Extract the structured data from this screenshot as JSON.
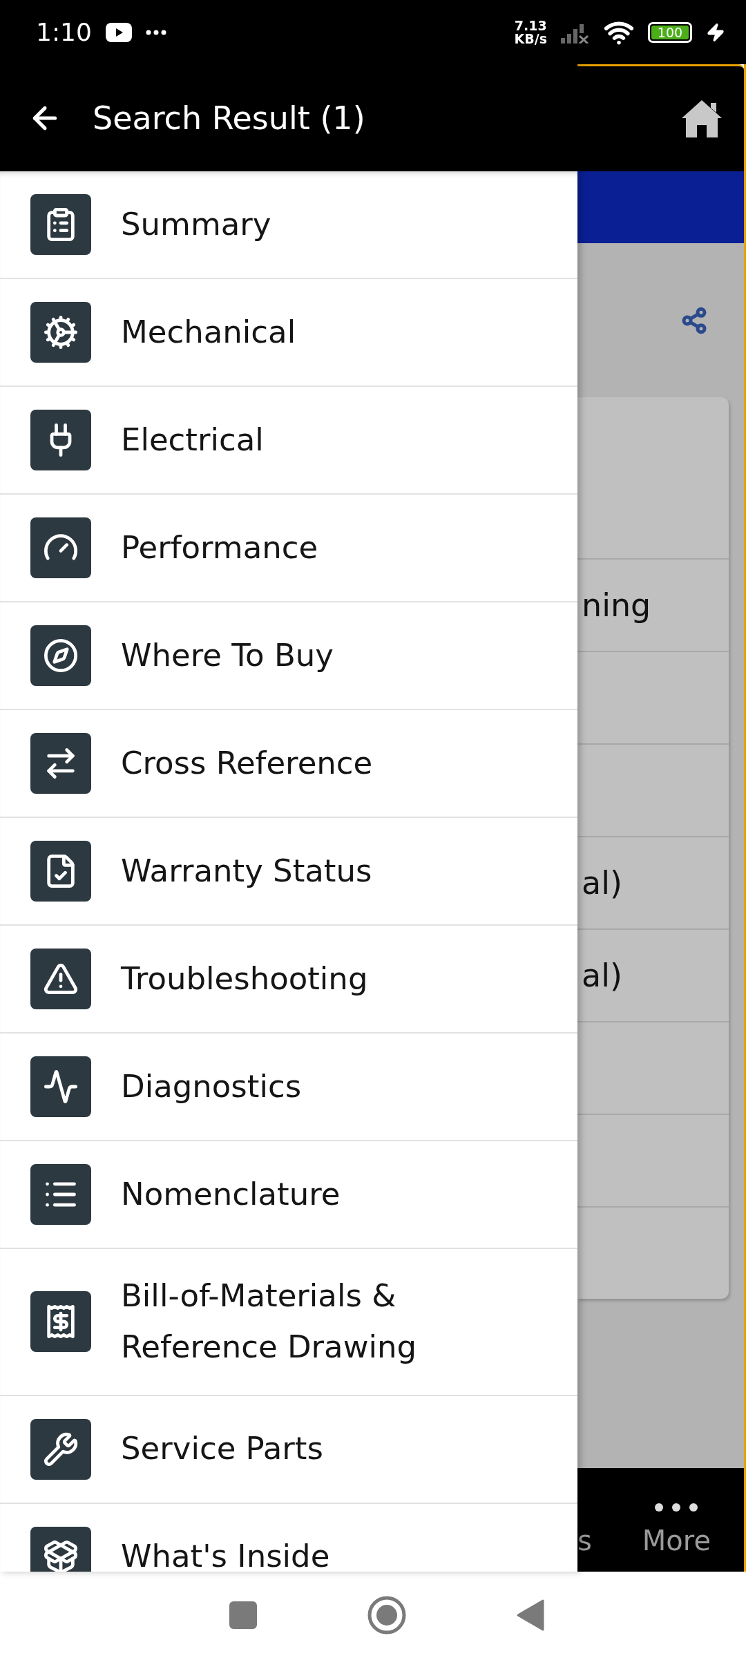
{
  "status_bar": {
    "time": "1:10",
    "net_speed": "7.13",
    "net_unit": "KB/s",
    "battery": "100"
  },
  "header": {
    "title": "Search Result (1)"
  },
  "drawer": {
    "items": [
      {
        "label": "Summary"
      },
      {
        "label": "Mechanical"
      },
      {
        "label": "Electrical"
      },
      {
        "label": "Performance"
      },
      {
        "label": "Where To Buy"
      },
      {
        "label": "Cross Reference"
      },
      {
        "label": "Warranty Status"
      },
      {
        "label": "Troubleshooting"
      },
      {
        "label": "Diagnostics"
      },
      {
        "label": "Nomenclature"
      },
      {
        "label": "Bill-of-Materials & Reference Drawing"
      },
      {
        "label": "Service Parts"
      },
      {
        "label": "What's Inside"
      }
    ]
  },
  "background": {
    "card_rows": [
      {
        "kind": "blank"
      },
      {
        "kind": "text",
        "text": "ning"
      },
      {
        "kind": "blank"
      },
      {
        "kind": "blank"
      },
      {
        "kind": "text",
        "text": "al)"
      },
      {
        "kind": "text",
        "text": "al)"
      },
      {
        "kind": "blank"
      },
      {
        "kind": "blank"
      },
      {
        "kind": "blank"
      }
    ],
    "bottom_nav": [
      {
        "kind": "plain",
        "label": "s"
      },
      {
        "kind": "more",
        "label": "More"
      }
    ]
  }
}
